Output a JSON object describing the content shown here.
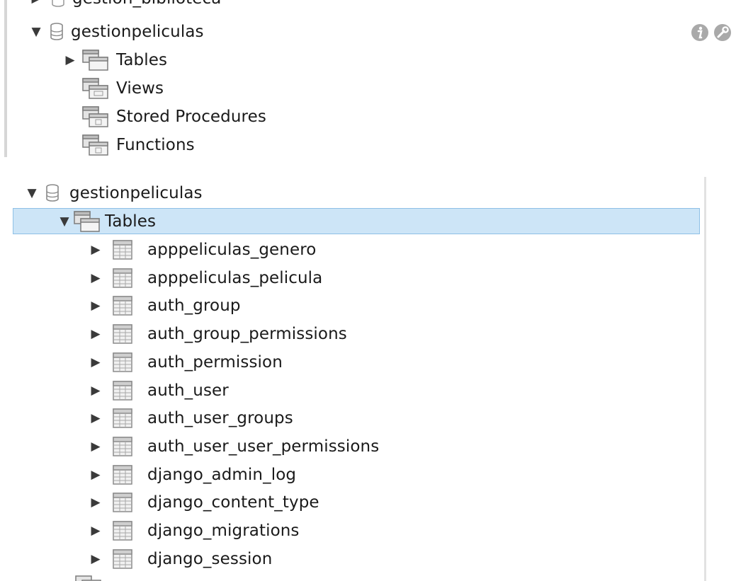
{
  "panel_top": {
    "cut_label": "gestion_biblioteca",
    "schema": "gestionpeliculas",
    "children": [
      {
        "label": "Tables",
        "icon": "tables-folder-icon"
      },
      {
        "label": "Views",
        "icon": "views-folder-icon"
      },
      {
        "label": "Stored Procedures",
        "icon": "procedures-folder-icon"
      },
      {
        "label": "Functions",
        "icon": "functions-folder-icon"
      }
    ],
    "action_icons": [
      "info-icon",
      "wrench-icon"
    ]
  },
  "panel_bottom": {
    "schema": "gestionpeliculas",
    "tables_label": "Tables",
    "tables": [
      "apppeliculas_genero",
      "apppeliculas_pelicula",
      "auth_group",
      "auth_group_permissions",
      "auth_permission",
      "auth_user",
      "auth_user_groups",
      "auth_user_user_permissions",
      "django_admin_log",
      "django_content_type",
      "django_migrations",
      "django_session"
    ]
  },
  "colors": {
    "selection": "#cde5f7",
    "selection_border": "#8ec0e6"
  }
}
